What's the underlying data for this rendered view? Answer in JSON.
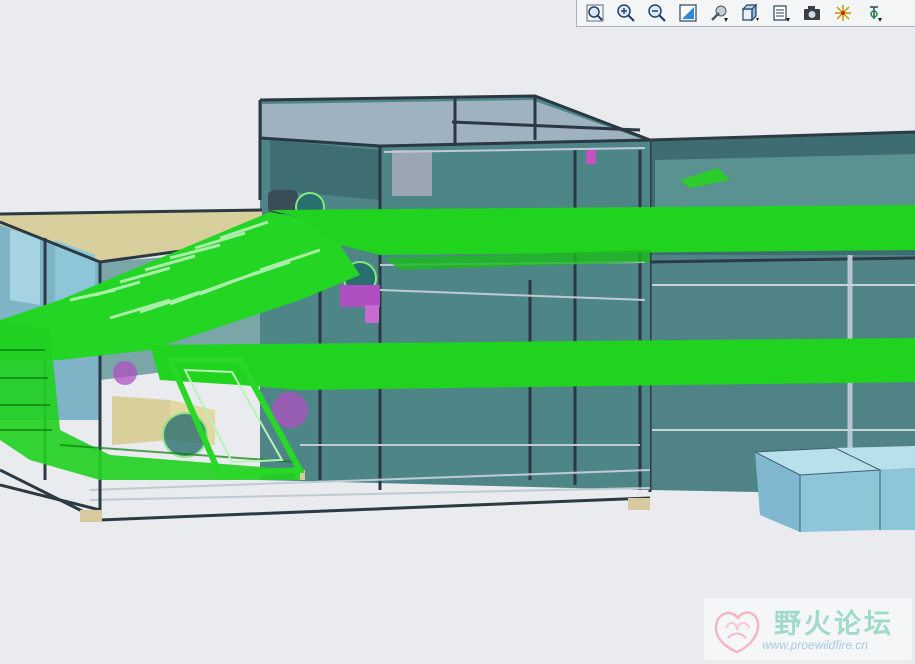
{
  "toolbar": {
    "buttons": [
      {
        "name": "zoom-fit-icon"
      },
      {
        "name": "zoom-in-icon"
      },
      {
        "name": "zoom-out-icon"
      },
      {
        "name": "repaint-icon"
      },
      {
        "name": "orient-icon"
      },
      {
        "name": "display-style-icon"
      },
      {
        "name": "saved-views-icon"
      },
      {
        "name": "camera-icon"
      },
      {
        "name": "spin-center-icon"
      },
      {
        "name": "datum-display-icon"
      }
    ]
  },
  "watermark": {
    "title": "野火论坛",
    "url": "www.proewildfire.cn"
  },
  "colors": {
    "background": "#e9ebee",
    "belt": "#1fd31f",
    "frame": "#4f7f82",
    "panel": "#5e9a9a",
    "bin": "#8cc6d8",
    "hopper": "#d9cf9a",
    "gearbox": "#b04fc1"
  }
}
